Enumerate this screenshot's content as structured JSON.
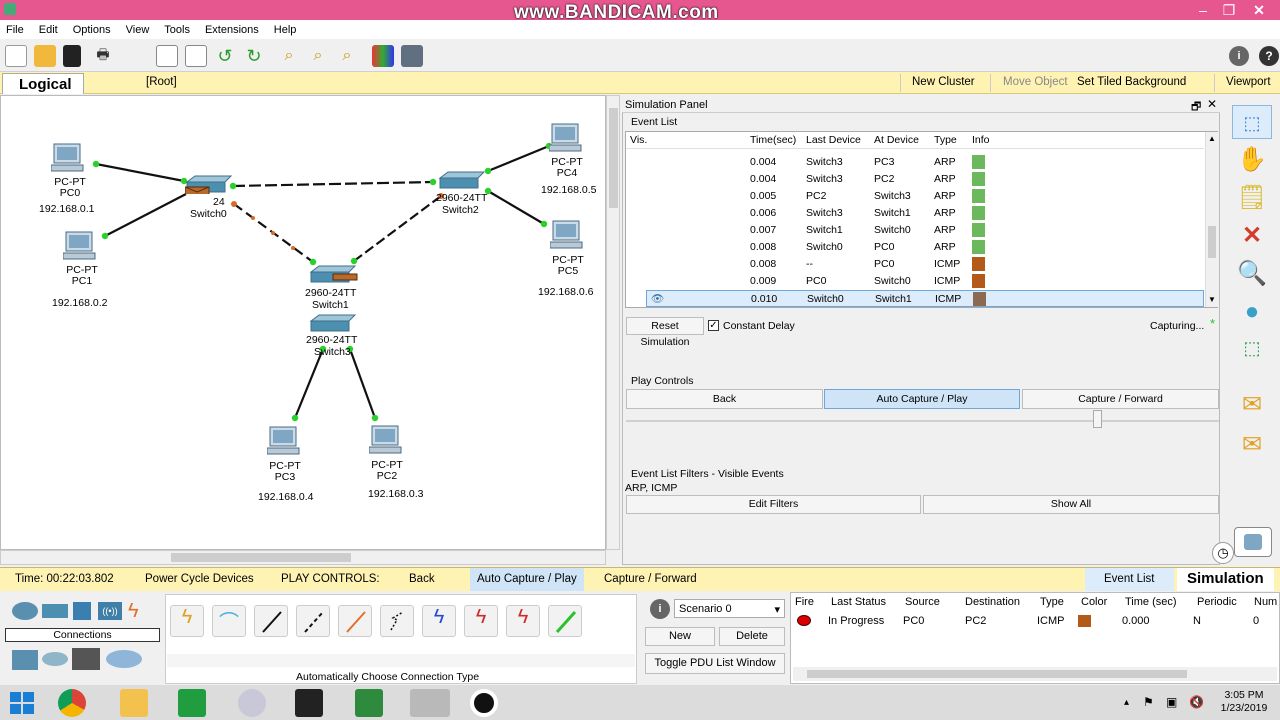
{
  "window": {
    "watermark": "www.BANDICAM.com"
  },
  "menu": [
    "File",
    "Edit",
    "Options",
    "View",
    "Tools",
    "Extensions",
    "Help"
  ],
  "logical_bar": {
    "tab": "Logical",
    "root": "[Root]",
    "new_cluster": "New Cluster",
    "move_object": "Move Object",
    "tiled_bg": "Set Tiled Background",
    "viewport": "Viewport"
  },
  "devices": [
    {
      "name": "PC-PT",
      "label": "PC0",
      "ip": "192.168.0.1"
    },
    {
      "name": "PC-PT",
      "label": "PC1",
      "ip": "192.168.0.2"
    },
    {
      "name": "PC-PT",
      "label": "PC4",
      "ip": "192.168.0.5"
    },
    {
      "name": "PC-PT",
      "label": "PC5",
      "ip": "192.168.0.6"
    },
    {
      "name": "PC-PT",
      "label": "PC3",
      "ip": "192.168.0.4"
    },
    {
      "name": "PC-PT",
      "label": "PC2",
      "ip": "192.168.0.3"
    },
    {
      "model": "2960-24TT",
      "label": "Switch0",
      "model_short": "24"
    },
    {
      "model": "2960-24TT",
      "label": "Switch2"
    },
    {
      "model": "2960-24TT",
      "label": "Switch1"
    },
    {
      "model": "2960-24TT",
      "label": "Switch3"
    }
  ],
  "sim_panel": {
    "title": "Simulation Panel",
    "event_list_label": "Event List",
    "columns": [
      "Vis.",
      "Time(sec)",
      "Last Device",
      "At Device",
      "Type",
      "Info"
    ],
    "events": [
      {
        "time": "0.004",
        "last": "Switch3",
        "at": "PC3",
        "type": "ARP",
        "color": "#6cb85c"
      },
      {
        "time": "0.004",
        "last": "Switch3",
        "at": "PC2",
        "type": "ARP",
        "color": "#6cb85c"
      },
      {
        "time": "0.005",
        "last": "PC2",
        "at": "Switch3",
        "type": "ARP",
        "color": "#6cb85c"
      },
      {
        "time": "0.006",
        "last": "Switch3",
        "at": "Switch1",
        "type": "ARP",
        "color": "#6cb85c"
      },
      {
        "time": "0.007",
        "last": "Switch1",
        "at": "Switch0",
        "type": "ARP",
        "color": "#6cb85c"
      },
      {
        "time": "0.008",
        "last": "Switch0",
        "at": "PC0",
        "type": "ARP",
        "color": "#6cb85c"
      },
      {
        "time": "0.008",
        "last": "--",
        "at": "PC0",
        "type": "ICMP",
        "color": "#b35a1a"
      },
      {
        "time": "0.009",
        "last": "PC0",
        "at": "Switch0",
        "type": "ICMP",
        "color": "#b35a1a"
      },
      {
        "time": "0.010",
        "last": "Switch0",
        "at": "Switch1",
        "type": "ICMP",
        "color": "#8a6b52"
      }
    ],
    "reset_label": "Reset Simulation",
    "constant_delay": "Constant Delay",
    "capturing": "Capturing...",
    "play_controls": "Play Controls",
    "back": "Back",
    "auto_capture": "Auto Capture / Play",
    "capture_forward": "Capture / Forward",
    "filters_label": "Event List Filters - Visible Events",
    "filters_value": "ARP, ICMP",
    "edit_filters": "Edit Filters",
    "show_all": "Show All"
  },
  "status": {
    "time": "Time: 00:22:03.802",
    "power": "Power Cycle Devices",
    "play": "PLAY CONTROLS:",
    "back": "Back",
    "auto": "Auto Capture / Play",
    "forward": "Capture / Forward",
    "event_list": "Event List",
    "simulation": "Simulation"
  },
  "bottom": {
    "connections": "Connections",
    "auto_conn": "Automatically Choose Connection Type",
    "scenario": "Scenario 0",
    "new": "New",
    "delete": "Delete",
    "toggle": "Toggle PDU List Window",
    "pdu_columns": [
      "Fire",
      "Last Status",
      "Source",
      "Destination",
      "Type",
      "Color",
      "Time (sec)",
      "Periodic",
      "Num"
    ],
    "pdu_row": {
      "status": "In Progress",
      "source": "PC0",
      "dest": "PC2",
      "type": "ICMP",
      "color": "#b35a1a",
      "time": "0.000",
      "periodic": "N",
      "num": "0"
    }
  },
  "taskbar": {
    "time": "3:05 PM",
    "date": "1/23/2019"
  }
}
